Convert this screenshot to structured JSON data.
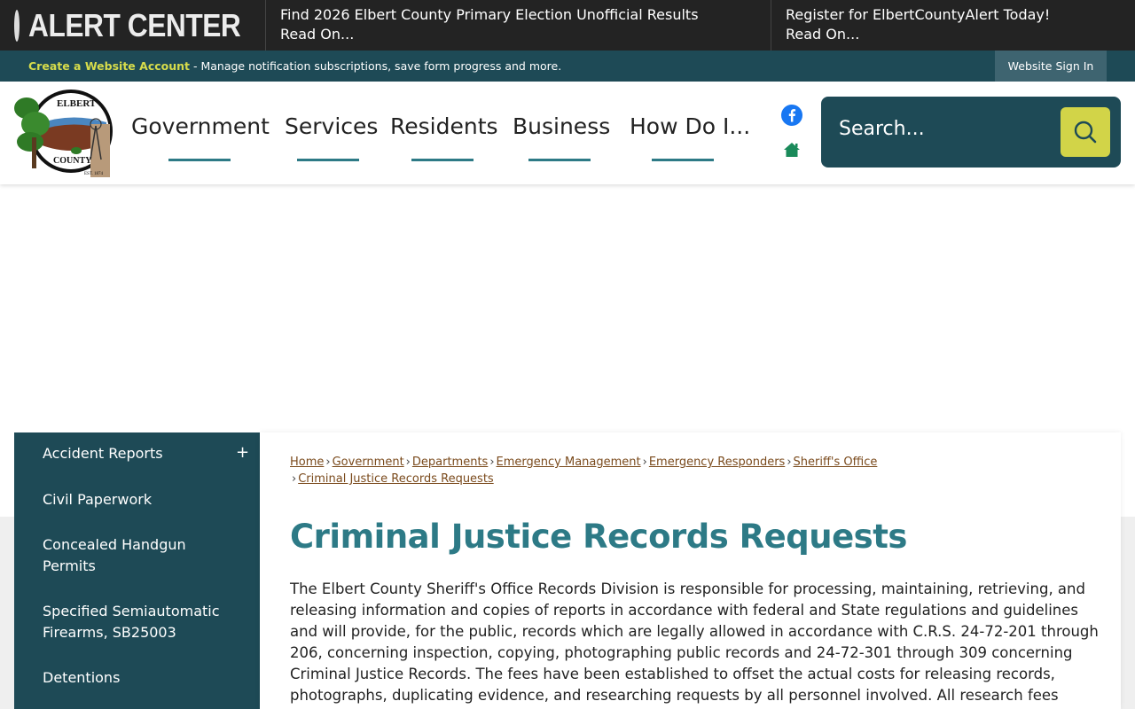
{
  "alert_center": {
    "title": "ALERT CENTER",
    "items": [
      {
        "headline": "Find 2026 Elbert County Primary Election Unofficial Results",
        "link": "Read On..."
      },
      {
        "headline": "Register for ElbertCountyAlert Today!",
        "link": "Read On..."
      }
    ]
  },
  "account_bar": {
    "create_link": "Create a Website Account",
    "description": " - Manage notification subscriptions, save form progress and more.",
    "sign_in": "Website Sign In"
  },
  "logo": {
    "top_text": "ELBERT",
    "bottom_text": "COUNTY",
    "est_text": "EST. 1874"
  },
  "nav": {
    "items": [
      "Government",
      "Services",
      "Residents",
      "Business",
      "How Do I..."
    ]
  },
  "social": {
    "icons": [
      "facebook-icon",
      "home-icon"
    ]
  },
  "search": {
    "placeholder": "Search..."
  },
  "sidebar": {
    "items": [
      {
        "label": "Accident Reports",
        "expand": "+"
      },
      {
        "label": "Civil Paperwork"
      },
      {
        "label": "Concealed Handgun Permits"
      },
      {
        "label": "Specified Semiautomatic Firearms, SB25003"
      },
      {
        "label": "Detentions"
      }
    ]
  },
  "breadcrumb": {
    "items": [
      "Home",
      "Government",
      "Departments",
      "Emergency Management",
      "Emergency Responders",
      "Sheriff's Office",
      "Criminal Justice Records Requests"
    ],
    "separator": "›"
  },
  "page": {
    "title": "Criminal Justice Records Requests",
    "body": "The Elbert County Sheriff's Office Records Division is responsible for processing, maintaining, retrieving, and releasing information and copies of reports in accordance with federal and State regulations and guidelines and will provide, for the public, records which are legally allowed in accordance with C.R.S. 24-72-201 through 206, concerning inspection, copying, photographing public records and 24-72-301 through 309 concerning Criminal Justice Records. The fees have been established to offset the actual costs for releasing records, photographs, duplicating evidence, and researching requests by all personnel involved. All research fees and/or redacting fees"
  },
  "colors": {
    "dark_teal": "#1e4a56",
    "accent_teal": "#2d7a86",
    "accent_yellow": "#d2d448",
    "link_brown": "#7a4a1c"
  }
}
